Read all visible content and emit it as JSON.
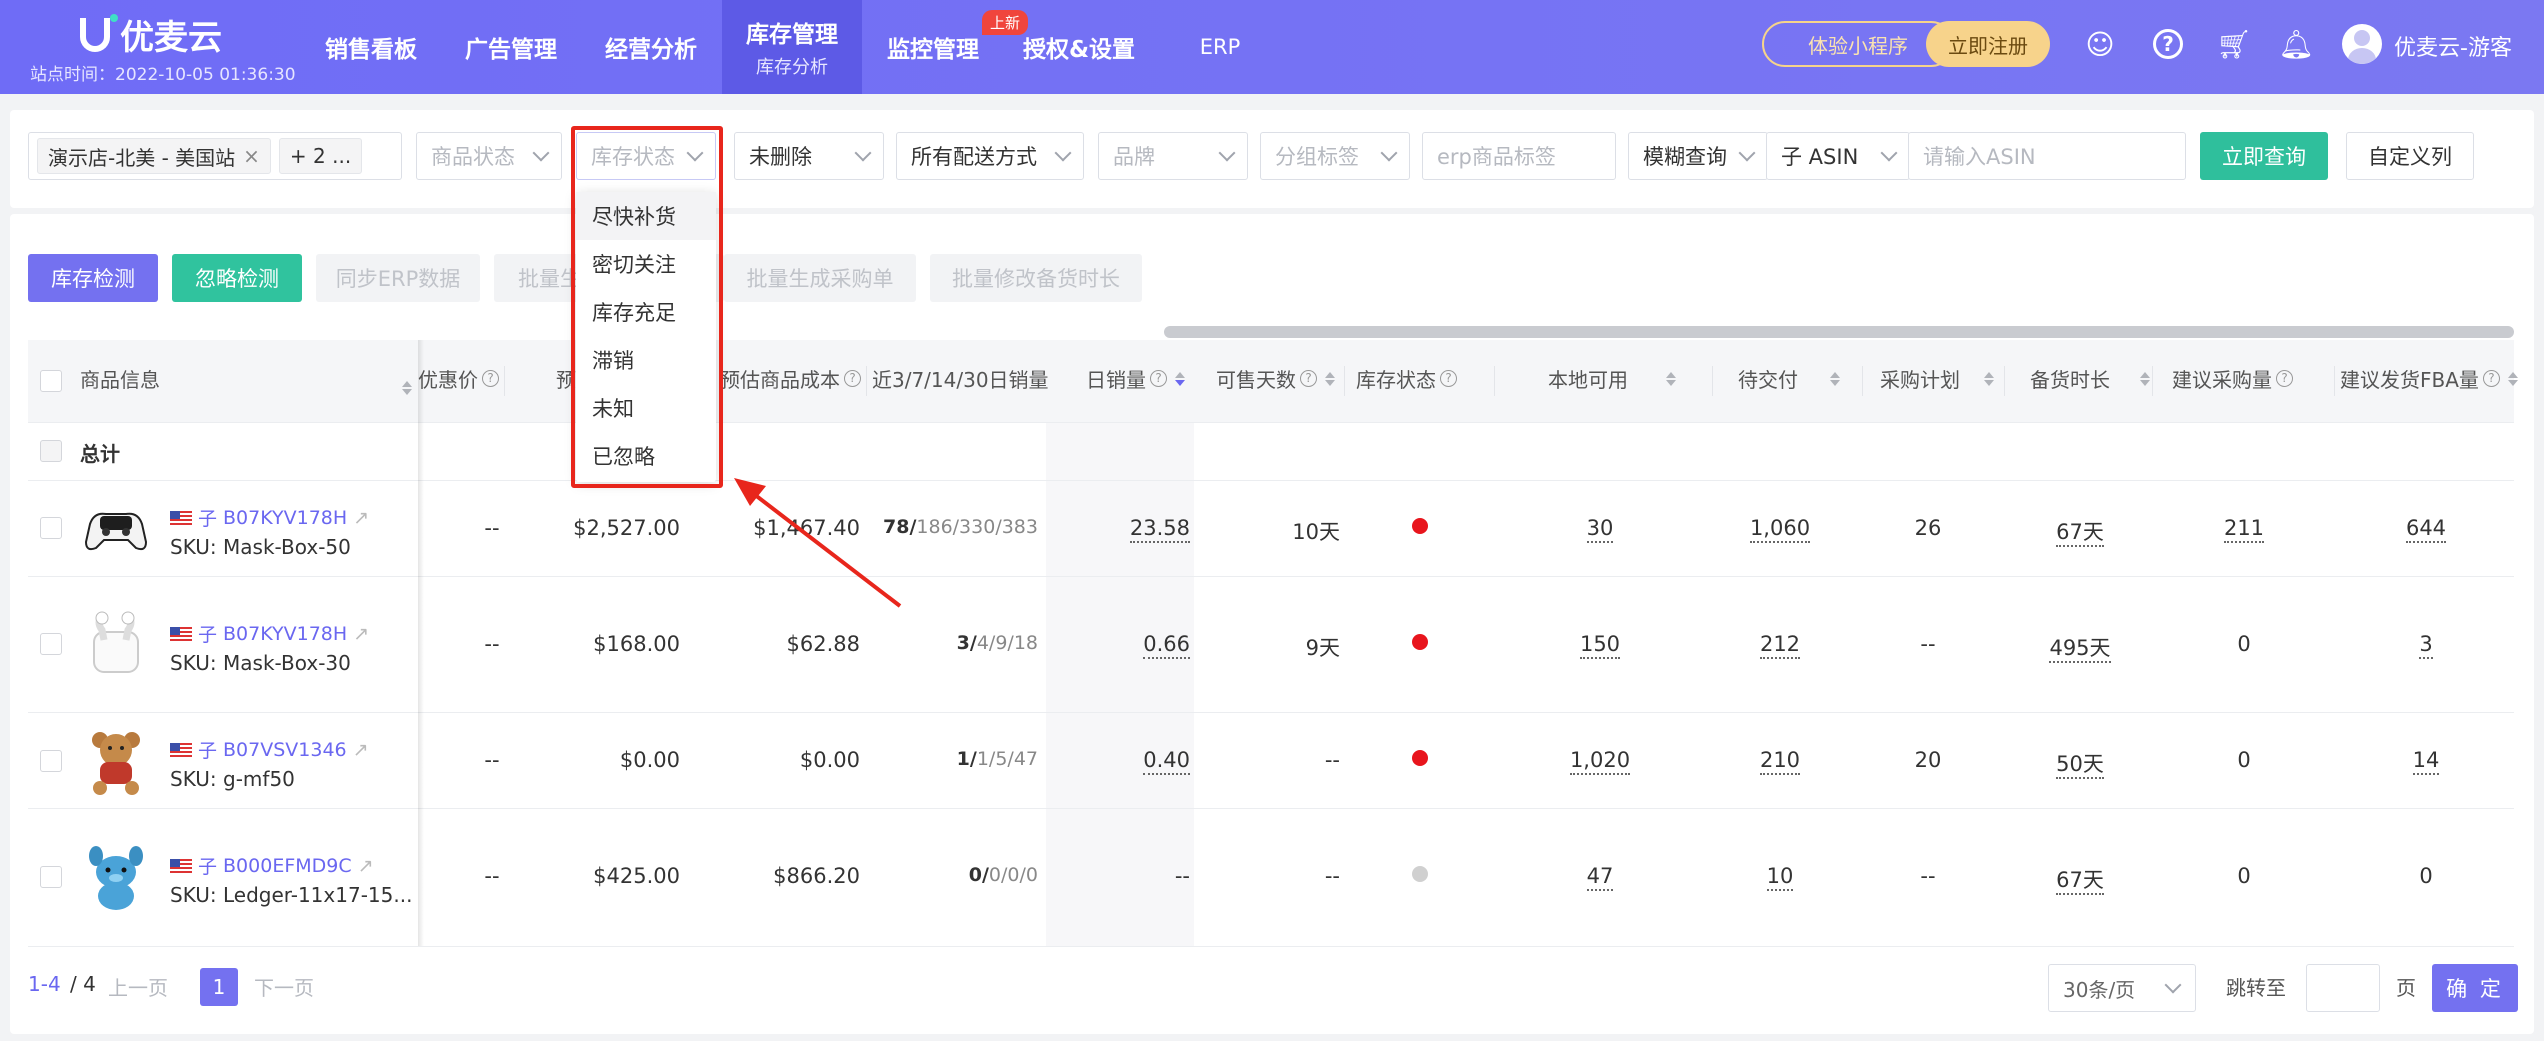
{
  "nav": {
    "logo": "优麦云",
    "station_time": "站点时间：2022-10-05 01:36:30",
    "items": [
      {
        "label": "销售看板"
      },
      {
        "label": "广告管理"
      },
      {
        "label": "经营分析"
      },
      {
        "label": "库存管理",
        "sub": "库存分析",
        "active": true
      },
      {
        "label": "监控管理",
        "badge": "上新"
      },
      {
        "label": "授权&设置"
      },
      {
        "label": "ERP"
      }
    ],
    "mini_program": "体验小程序",
    "register": "立即注册",
    "user": "优麦云-游客"
  },
  "filters": {
    "store_tag": "演示店-北美 - 美国站",
    "more_tag": "+ 2 ...",
    "product_status": "商品状态",
    "stock_status": "库存状态",
    "deleted": "未删除",
    "delivery": "所有配送方式",
    "brand": "品牌",
    "group_tag": "分组标签",
    "erp_tag_placeholder": "erp商品标签",
    "match_mode": "模糊查询",
    "asin_type": "子 ASIN",
    "asin_placeholder": "请输入ASIN",
    "query": "立即查询",
    "custom_columns": "自定义列"
  },
  "dropdown": {
    "items": [
      "尽快补货",
      "密切关注",
      "库存充足",
      "滞销",
      "未知",
      "已忽略"
    ],
    "highlighted": 0
  },
  "actions": {
    "detect": "库存检测",
    "ignore": "忽略检测",
    "sync_erp": "同步ERP数据",
    "batch": "批量生",
    "batch_purchase": "批量生成采购单",
    "batch_duration": "批量修改备货时长"
  },
  "table": {
    "headers": {
      "product": "商品信息",
      "promo_price": "优惠价",
      "est": "预",
      "est_cost": "预估商品成本",
      "sales_window": "近3/7/14/30日销量",
      "daily": "日销量",
      "days": "可售天数",
      "stock_status": "库存状态",
      "local": "本地可用",
      "pending": "待交付",
      "plan": "采购计划",
      "lead": "备货时长",
      "suggest_purchase": "建议采购量",
      "suggest_fba": "建议发货FBA量"
    },
    "total_label": "总计",
    "rows": [
      {
        "child": "子",
        "asin": "B07KYV178H",
        "sku": "SKU: Mask-Box-50",
        "promo": "--",
        "price": "$2,527.00",
        "cost": "$1,467.40",
        "s_bold": "78/",
        "s_rest": "186/330/383",
        "daily": "23.58",
        "days": "10天",
        "status_color": "#e8151d",
        "local": "30",
        "pending": "1,060",
        "plan": "26",
        "lead": "67天",
        "sp": "211",
        "sf": "644"
      },
      {
        "child": "子",
        "asin": "B07KYV178H",
        "sku": "SKU: Mask-Box-30",
        "promo": "--",
        "price": "$168.00",
        "cost": "$62.88",
        "s_bold": "3/",
        "s_rest": "4/9/18",
        "daily": "0.66",
        "days": "9天",
        "status_color": "#e8151d",
        "local": "150",
        "pending": "212",
        "plan": "--",
        "lead": "495天",
        "sp": "0",
        "sf": "3"
      },
      {
        "child": "子",
        "asin": "B07VSV1346",
        "sku": "SKU: g-mf50",
        "promo": "--",
        "price": "$0.00",
        "cost": "$0.00",
        "s_bold": "1/",
        "s_rest": "1/5/47",
        "daily": "0.40",
        "days": "--",
        "status_color": "#e8151d",
        "local": "1,020",
        "pending": "210",
        "plan": "20",
        "lead": "50天",
        "sp": "0",
        "sf": "14"
      },
      {
        "child": "子",
        "asin": "B000EFMD9C",
        "sku": "SKU: Ledger-11x17-15...",
        "promo": "--",
        "price": "$425.00",
        "cost": "$866.20",
        "s_bold": "0/",
        "s_rest": "0/0/0",
        "daily": "--",
        "days": "--",
        "status_color": "#d0d0d0",
        "local": "47",
        "pending": "10",
        "plan": "--",
        "lead": "67天",
        "sp": "0",
        "sf": "0"
      }
    ]
  },
  "pagination": {
    "range": "1-4",
    "total": "/ 4",
    "prev": "上一页",
    "current": "1",
    "next": "下一页",
    "page_size": "30条/页",
    "jump_label": "跳转至",
    "page_unit": "页",
    "confirm": "确 定"
  }
}
